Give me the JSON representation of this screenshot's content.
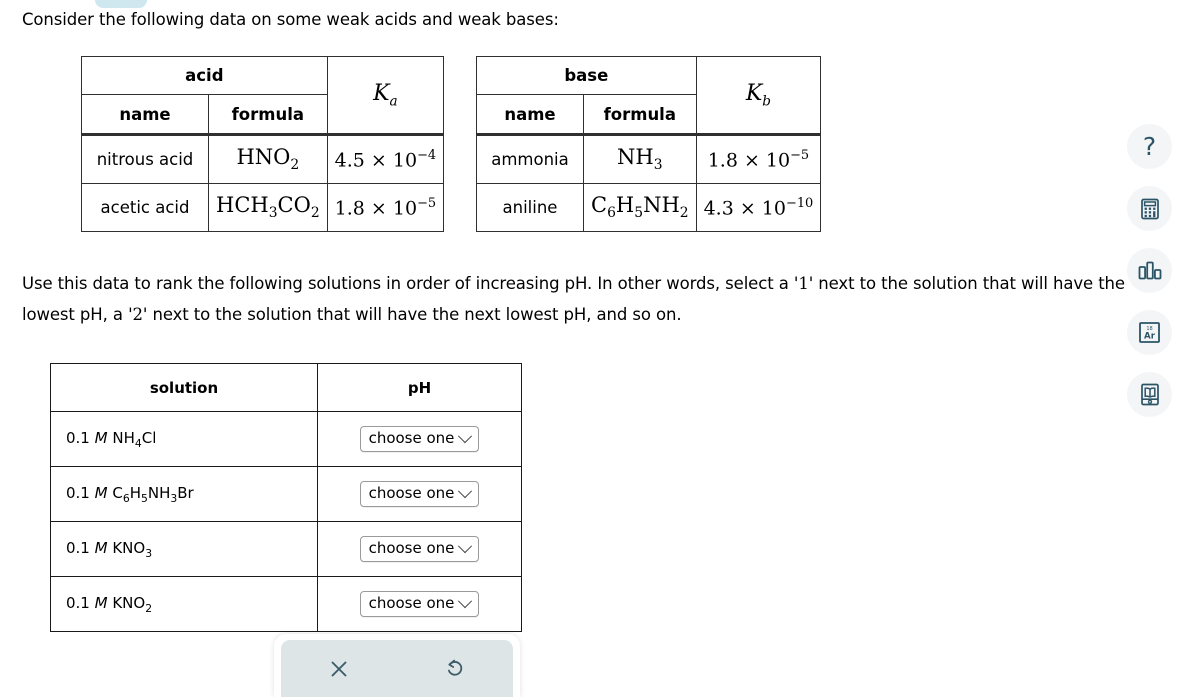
{
  "prompt": {
    "intro": "Consider the following data on some weak acids and weak bases:",
    "body_part1": "Use this data to rank the following solutions in order of increasing pH. In other words, select a '",
    "body_rank1": "1",
    "body_part2": "' next to the solution that will have the lowest pH, a '",
    "body_rank2": "2",
    "body_part3": "' next to the solution that will have the next lowest pH, and so on."
  },
  "acid_table": {
    "group_header": "acid",
    "k_header_symbol": "K",
    "k_header_subscript": "a",
    "columns": [
      "name",
      "formula"
    ],
    "rows": [
      {
        "name": "nitrous acid",
        "formula_parts": [
          {
            "t": "HNO",
            "sub": false
          },
          {
            "t": "2",
            "sub": true
          }
        ],
        "k_mantissa": "4.5 × 10",
        "k_exponent": "−4"
      },
      {
        "name": "acetic acid",
        "formula_parts": [
          {
            "t": "HCH",
            "sub": false
          },
          {
            "t": "3",
            "sub": true
          },
          {
            "t": "CO",
            "sub": false
          },
          {
            "t": "2",
            "sub": true
          }
        ],
        "k_mantissa": "1.8 × 10",
        "k_exponent": "−5"
      }
    ]
  },
  "base_table": {
    "group_header": "base",
    "k_header_symbol": "K",
    "k_header_subscript": "b",
    "columns": [
      "name",
      "formula"
    ],
    "rows": [
      {
        "name": "ammonia",
        "formula_parts": [
          {
            "t": "NH",
            "sub": false
          },
          {
            "t": "3",
            "sub": true
          }
        ],
        "k_mantissa": "1.8 × 10",
        "k_exponent": "−5"
      },
      {
        "name": "aniline",
        "formula_parts": [
          {
            "t": "C",
            "sub": false
          },
          {
            "t": "6",
            "sub": true
          },
          {
            "t": "H",
            "sub": false
          },
          {
            "t": "5",
            "sub": true
          },
          {
            "t": "NH",
            "sub": false
          },
          {
            "t": "2",
            "sub": true
          }
        ],
        "k_mantissa": "4.3 × 10",
        "k_exponent": "−10"
      }
    ]
  },
  "solution_table": {
    "headers": [
      "solution",
      "pH"
    ],
    "rows": [
      {
        "solution_parts": [
          {
            "t": "0.1 ",
            "sub": false,
            "ital": false
          },
          {
            "t": "M",
            "sub": false,
            "ital": true
          },
          {
            "t": " NH",
            "sub": false,
            "ital": false
          },
          {
            "t": "4",
            "sub": true,
            "ital": false
          },
          {
            "t": "Cl",
            "sub": false,
            "ital": false
          }
        ],
        "ph_value": "choose one"
      },
      {
        "solution_parts": [
          {
            "t": "0.1 ",
            "sub": false,
            "ital": false
          },
          {
            "t": "M",
            "sub": false,
            "ital": true
          },
          {
            "t": " C",
            "sub": false,
            "ital": false
          },
          {
            "t": "6",
            "sub": true,
            "ital": false
          },
          {
            "t": "H",
            "sub": false,
            "ital": false
          },
          {
            "t": "5",
            "sub": true,
            "ital": false
          },
          {
            "t": "NH",
            "sub": false,
            "ital": false
          },
          {
            "t": "3",
            "sub": true,
            "ital": false
          },
          {
            "t": "Br",
            "sub": false,
            "ital": false
          }
        ],
        "ph_value": "choose one"
      },
      {
        "solution_parts": [
          {
            "t": "0.1 ",
            "sub": false,
            "ital": false
          },
          {
            "t": "M",
            "sub": false,
            "ital": true
          },
          {
            "t": " KNO",
            "sub": false,
            "ital": false
          },
          {
            "t": "3",
            "sub": true,
            "ital": false
          }
        ],
        "ph_value": "choose one"
      },
      {
        "solution_parts": [
          {
            "t": "0.1 ",
            "sub": false,
            "ital": false
          },
          {
            "t": "M",
            "sub": false,
            "ital": true
          },
          {
            "t": " KNO",
            "sub": false,
            "ital": false
          },
          {
            "t": "2",
            "sub": true,
            "ital": false
          }
        ],
        "ph_value": "choose one"
      }
    ]
  },
  "tool_rail": {
    "items": [
      {
        "icon": "question-mark-icon",
        "label": "help"
      },
      {
        "icon": "calculator-icon",
        "label": "calculator"
      },
      {
        "icon": "bar-chart-icon",
        "label": "data"
      },
      {
        "icon": "periodic-table-icon",
        "label": "periodic table",
        "element_symbol": "Ar",
        "element_number": "18"
      },
      {
        "icon": "reference-book-icon",
        "label": "reference"
      }
    ]
  },
  "bottom_toolbar": {
    "buttons": [
      {
        "icon": "close-x-icon",
        "label": "clear"
      },
      {
        "icon": "reset-undo-icon",
        "label": "reset"
      }
    ]
  },
  "colors": {
    "icon_teal": "#2b5566",
    "icon_bg": "#f3f5f7",
    "toolbar_bg": "#dde5e7",
    "tab_blue": "#cfe8ef",
    "table_border": "#303030"
  }
}
